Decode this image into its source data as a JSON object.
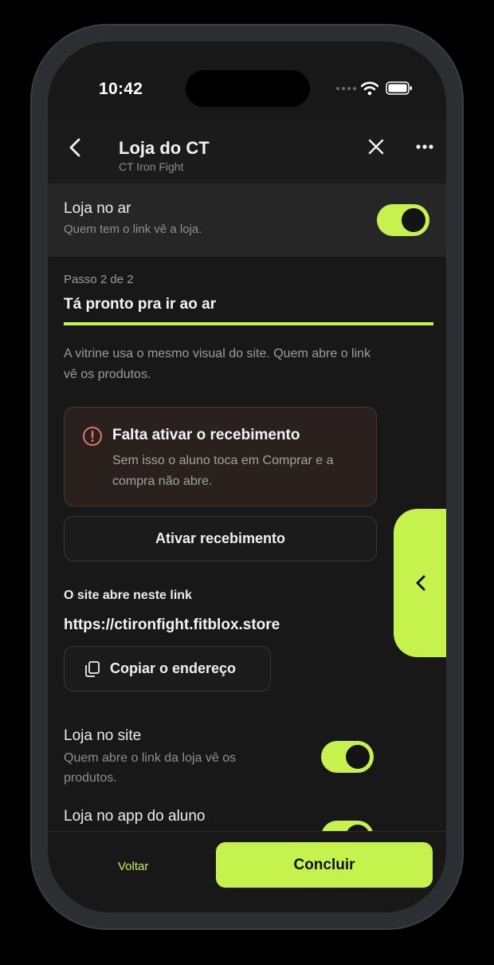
{
  "status": {
    "time": "10:42"
  },
  "header": {
    "title": "Loja do CT",
    "subtitle": "CT Iron Fight"
  },
  "store": {
    "label": "Loja no ar",
    "sub": "Quem tem o link vê a loja.",
    "enabled": true
  },
  "step": {
    "label": "Passo 2 de 2",
    "title": "Tá pronto pra ir ao ar",
    "progress": 1.0
  },
  "description": "A vitrine usa o mesmo visual do site. Quem abre o link vê os produtos.",
  "alert": {
    "title": "Falta ativar o recebimento",
    "body": "Sem isso o aluno toca em Comprar e a compra não abre."
  },
  "activate_button": "Ativar recebimento",
  "link": {
    "label": "O site abre neste link",
    "url": "https://ctironfight.fitblox.store",
    "copy_label": "Copiar o endereço"
  },
  "options": [
    {
      "label": "Loja no site",
      "sub": "Quem abre o link da loja vê os produtos.",
      "enabled": true
    },
    {
      "label": "Loja no app do aluno",
      "sub": "",
      "enabled": true
    }
  ],
  "footer": {
    "back": "Voltar",
    "finish": "Concluir"
  },
  "colors": {
    "accent": "#c6f24e",
    "background": "#181818",
    "alert_bg": "#2a201e",
    "alert_icon": "#e0786a"
  },
  "icons": [
    "back-icon",
    "close-icon",
    "more-icon",
    "alert-icon",
    "copy-icon",
    "chevron-left-icon",
    "wifi-icon",
    "battery-icon"
  ]
}
